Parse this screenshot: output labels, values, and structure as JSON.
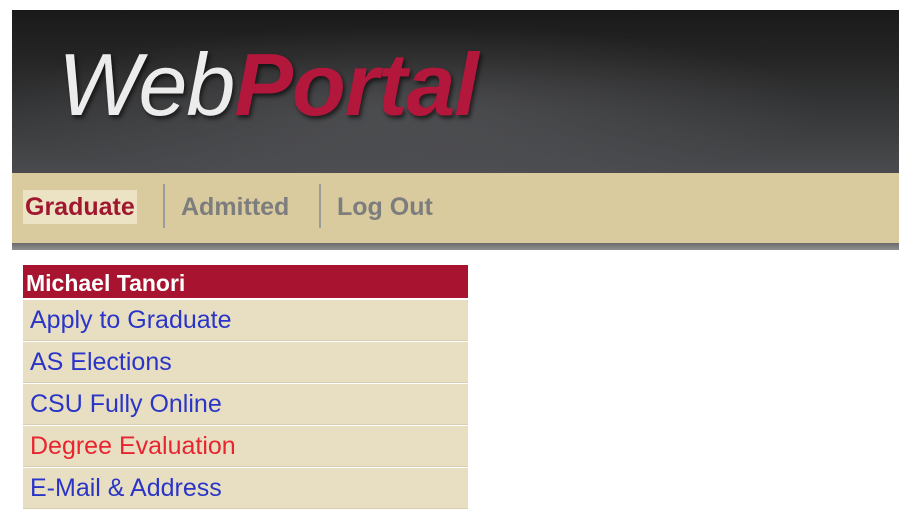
{
  "header": {
    "logo_web": "Web",
    "logo_portal": "Portal"
  },
  "nav": {
    "items": [
      {
        "label": "Graduate",
        "active": true
      },
      {
        "label": "Admitted",
        "active": false
      },
      {
        "label": "Log Out",
        "active": false
      }
    ]
  },
  "menu": {
    "user_name": "Michael Tanori",
    "items": [
      {
        "label": "Apply to Graduate"
      },
      {
        "label": "AS Elections"
      },
      {
        "label": "CSU Fully Online"
      },
      {
        "label": "Degree Evaluation",
        "highlight": true
      },
      {
        "label": "E-Mail & Address"
      }
    ]
  },
  "colors": {
    "brand_red": "#b3173b",
    "nav_background": "#d9cb9e",
    "menu_background": "#e8dfc3",
    "link_blue": "#2a35c8",
    "link_red": "#e8252f"
  }
}
